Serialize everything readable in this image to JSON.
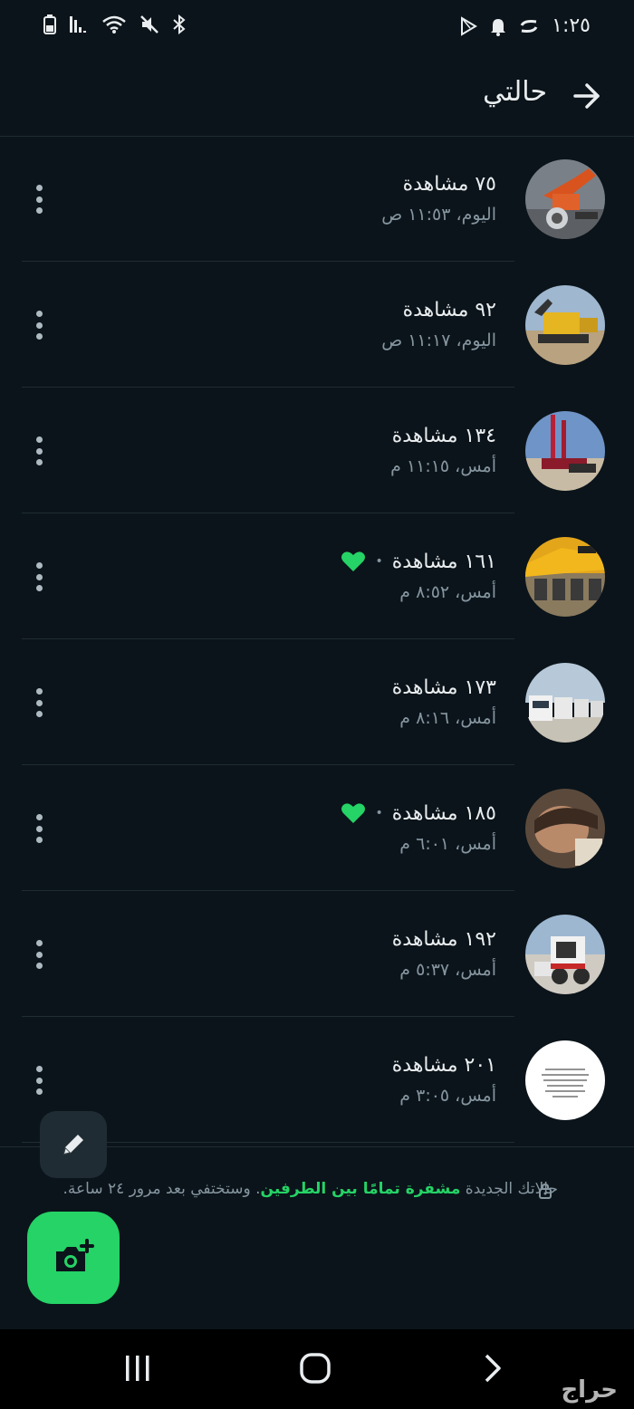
{
  "statusbar": {
    "time": "١:٢٥",
    "icons_left": [
      "battery-icon",
      "signal-icon",
      "wifi-icon",
      "mute-icon",
      "bluetooth-icon"
    ],
    "icons_right": [
      "play-store-icon",
      "notification-icon",
      "sync-icon"
    ]
  },
  "header": {
    "title": "حالتي"
  },
  "updates": [
    {
      "views": "٧٥ مشاهدة",
      "time": "اليوم، ١١:٥٣ ص",
      "liked": false,
      "thumb": "excavator"
    },
    {
      "views": "٩٢ مشاهدة",
      "time": "اليوم، ١١:١٧ ص",
      "liked": false,
      "thumb": "excavator-yellow"
    },
    {
      "views": "١٣٤ مشاهدة",
      "time": "أمس، ١١:١٥ م",
      "liked": false,
      "thumb": "drill-rig"
    },
    {
      "views": "١٦١ مشاهدة",
      "time": "أمس، ٨:٥٢ م",
      "liked": true,
      "thumb": "jcb-fleet"
    },
    {
      "views": "١٧٣ مشاهدة",
      "time": "أمس، ٨:١٦ م",
      "liked": false,
      "thumb": "trucks"
    },
    {
      "views": "١٨٥ مشاهدة",
      "time": "أمس، ٦:٠١ م",
      "liked": true,
      "thumb": "person"
    },
    {
      "views": "١٩٢ مشاهدة",
      "time": "أمس، ٥:٣٧ م",
      "liked": false,
      "thumb": "skid-steer"
    },
    {
      "views": "٢٠١ مشاهدة",
      "time": "أمس، ٣:٠٥ م",
      "liked": false,
      "thumb": "text-note"
    }
  ],
  "footer_note": {
    "pre": "حالاتك الجديدة",
    "highlight": "مشفرة تمامًا بين الطرفين",
    "post": ". وستختفي بعد مرور ٢٤ ساعة."
  },
  "watermark": "حراج",
  "colors": {
    "background": "#0b141a",
    "accent": "#25d366",
    "secondary_text": "#8696a0"
  }
}
